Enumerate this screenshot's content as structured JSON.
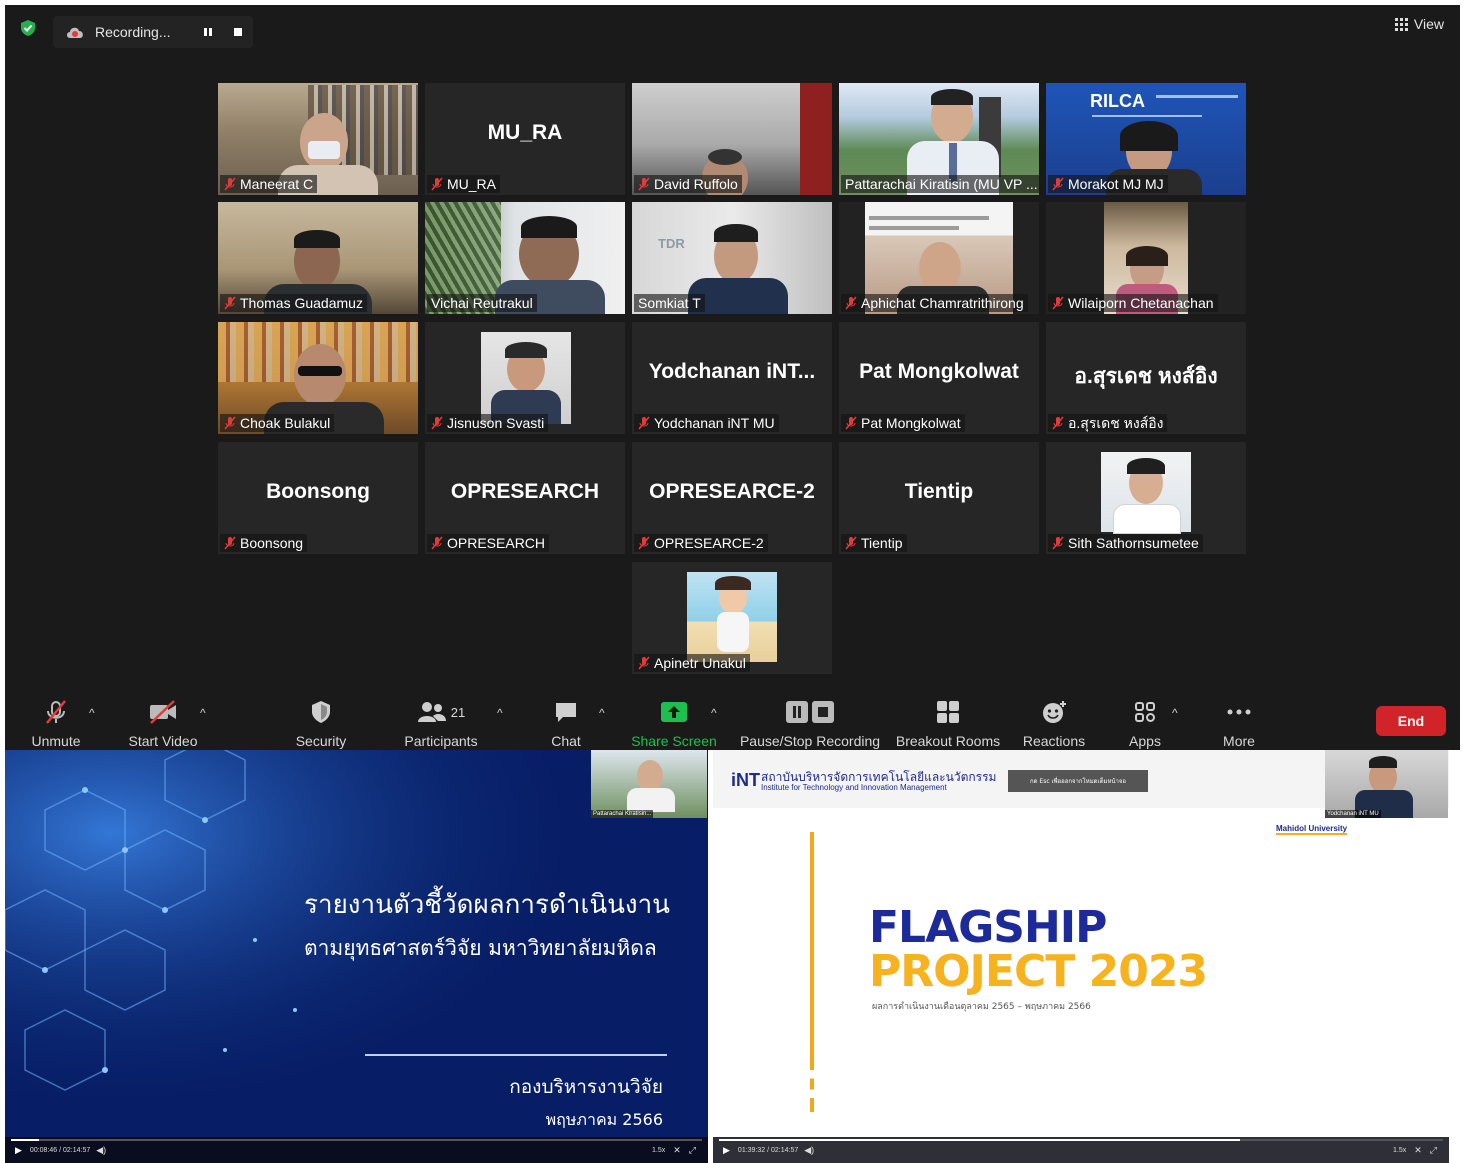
{
  "top_bar": {
    "recording_label": "Recording...",
    "view_label": "View"
  },
  "participants": {
    "maneerat": "Maneerat C",
    "mu_ra": "MU_RA",
    "mu_ra_tile": "MU_RA",
    "david": "David Ruffolo",
    "pattarachai": "Pattarachai Kiratisin (MU VP ...",
    "morakot": "Morakot MJ MJ",
    "thomas": "Thomas Guadamuz",
    "vichai": "Vichai Reutrakul",
    "somkiat": "Somkiat T",
    "aphichat": "Aphichat Chamratrithirong",
    "wilaiporn": "Wilaiporn Chetanachan",
    "choak": "Choak Bulakul",
    "jisnuson": "Jisnuson Svasti",
    "yodchanan": "Yodchanan iNT MU",
    "yodchanan_tile": "Yodchanan iNT...",
    "pat": "Pat Mongkolwat",
    "pat_tile": "Pat Mongkolwat",
    "suredech": "อ.สุรเดช หงส์อิง",
    "suredech_tile": "อ.สุรเดช หงส์อิง",
    "boonsong": "Boonsong",
    "boonsong_tile": "Boonsong",
    "opresearch": "OPRESEARCH",
    "opresearch_tile": "OPRESEARCH",
    "opresearce2": "OPRESEARCE-2",
    "opresearce2_tile": "OPRESEARCE-2",
    "tientip": "Tientip",
    "tientip_tile": "Tientip",
    "sith": "Sith Sathornsumetee",
    "apinetr": "Apinetr Unakul",
    "morakot_logo": "RILCA"
  },
  "toolbar": {
    "unmute": "Unmute",
    "start_video": "Start Video",
    "security": "Security",
    "participants_count": "21",
    "participants": "Participants",
    "chat": "Chat",
    "share_screen": "Share Screen",
    "pause_stop": "Pause/Stop Recording",
    "breakout": "Breakout Rooms",
    "reactions": "Reactions",
    "apps": "Apps",
    "more": "More",
    "end": "End",
    "share_color": "#1fbf4f",
    "end_color": "#d12428"
  },
  "left_slide": {
    "title_line1": "รายงานตัวชี้วัดผลการดำเนินงาน",
    "title_line2": "ตามยุทธศาสตร์วิจัย  มหาวิทยาลัยมหิดล",
    "department": "กองบริหารงานวิจัย",
    "date": "พฤษภาคม 2566",
    "thumb_name": "Pattarachai Kiratisin...",
    "player_time": "00:08:46 / 02:14:57",
    "speed": "1.5x"
  },
  "right_slide": {
    "org_thai": "สถาบันบริหารจัดการเทคโนโลยีและนวัตกรรม",
    "org_en": "Institute for Technology and Innovation Management",
    "logo": "iNT",
    "badge_text": "กด  Esc  เพื่อออกจากโหมดเต็มหน้าจอ",
    "university": "Mahidol University",
    "flagship": "FLAGSHIP",
    "project": "PROJECT 2023",
    "subtitle": "ผลการดำเนินงานเดือนตุลาคม 2565 – พฤษภาคม 2566",
    "thumb_name": "Yodchanan iNT MU",
    "player_time": "01:39:32 / 02:14:57",
    "speed": "1.5x"
  }
}
